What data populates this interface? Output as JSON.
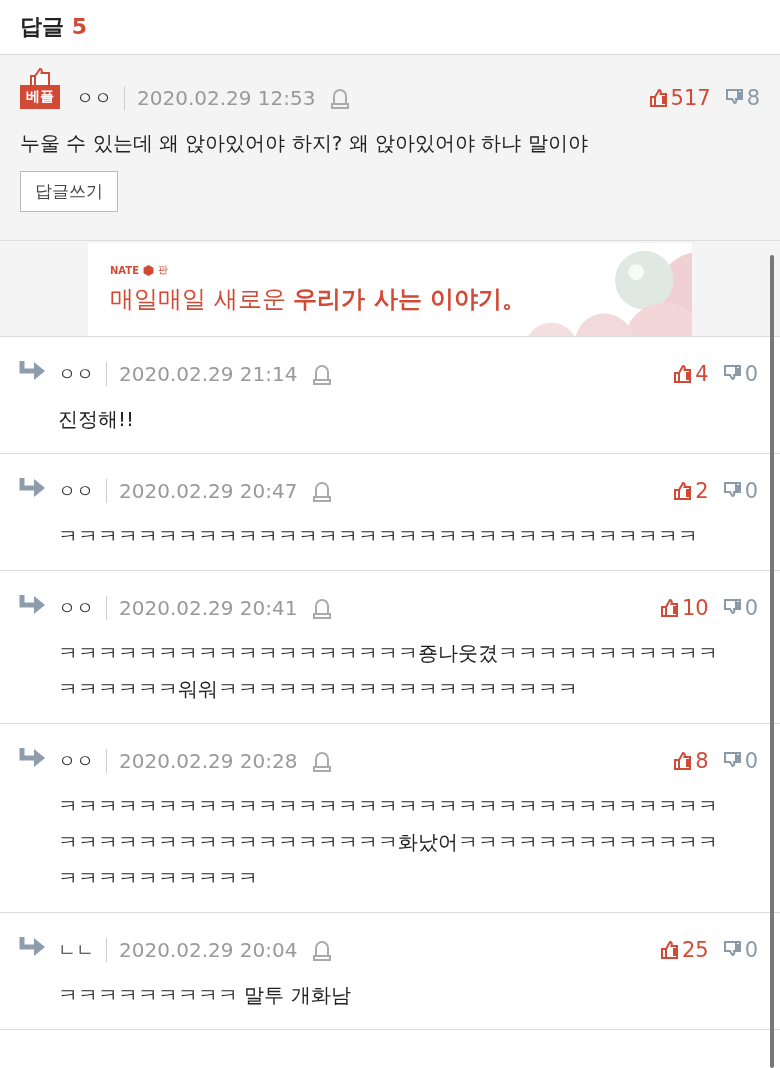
{
  "header": {
    "label": "답글",
    "count": "5"
  },
  "best": {
    "badge": "베플",
    "author": "ㅇㅇ",
    "date": "2020.02.29 12:53",
    "up": "517",
    "down": "8",
    "text": "누울 수 있는데 왜 앉아있어야 하지? 왜 앉아있어야 하냐 말이야",
    "reply_button": "답글쓰기"
  },
  "ad": {
    "brand": "NATE",
    "brand_suffix": "판",
    "headline": "매일매일 새로운 **우리가 사는 이야기。**",
    "kind": "picture"
  },
  "replies": [
    {
      "author": "ㅇㅇ",
      "date": "2020.02.29 21:14",
      "up": "4",
      "down": "0",
      "text": "진정해!!"
    },
    {
      "author": "ㅇㅇ",
      "date": "2020.02.29 20:47",
      "up": "2",
      "down": "0",
      "text": "ㅋㅋㅋㅋㅋㅋㅋㅋㅋㅋㅋㅋㅋㅋㅋㅋㅋㅋㅋㅋㅋㅋㅋㅋㅋㅋㅋㅋㅋㅋㅋㅋ"
    },
    {
      "author": "ㅇㅇ",
      "date": "2020.02.29 20:41",
      "up": "10",
      "down": "0",
      "text": "ㅋㅋㅋㅋㅋㅋㅋㅋㅋㅋㅋㅋㅋㅋㅋㅋㅋㅋ죵나웃겼ㅋㅋㅋㅋㅋㅋㅋㅋㅋㅋㅋㅋㅋㅋㅋㅋㅋ워워ㅋㅋㅋㅋㅋㅋㅋㅋㅋㅋㅋㅋㅋㅋㅋㅋㅋㅋ"
    },
    {
      "author": "ㅇㅇ",
      "date": "2020.02.29 20:28",
      "up": "8",
      "down": "0",
      "text": "ㅋㅋㅋㅋㅋㅋㅋㅋㅋㅋㅋㅋㅋㅋㅋㅋㅋㅋㅋㅋㅋㅋㅋㅋㅋㅋㅋㅋㅋㅋㅋㅋㅋㅋㅋㅋㅋㅋㅋㅋㅋㅋㅋㅋㅋㅋㅋㅋㅋㅋ화났어ㅋㅋㅋㅋㅋㅋㅋㅋㅋㅋㅋㅋㅋㅋㅋㅋㅋㅋㅋㅋㅋㅋㅋ"
    },
    {
      "author": "ㄴㄴ",
      "date": "2020.02.29 20:04",
      "up": "25",
      "down": "0",
      "text": "ㅋㅋㅋㅋㅋㅋㅋㅋㅋ 말투 개화남"
    }
  ]
}
